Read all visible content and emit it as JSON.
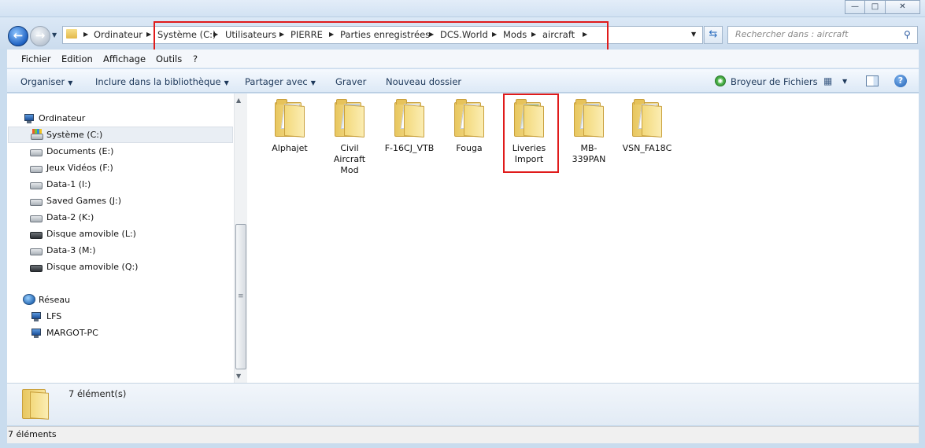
{
  "window": {
    "title": "",
    "minimize": "—",
    "maximize": "□",
    "close": "✕"
  },
  "address": {
    "crumbs": [
      "Ordinateur",
      "Système (C:)",
      "Utilisateurs",
      "PIERRE",
      "Parties enregistrées",
      "DCS.World",
      "Mods",
      "aircraft"
    ],
    "search_placeholder": "Rechercher dans : aircraft"
  },
  "menu": {
    "items": [
      "Fichier",
      "Edition",
      "Affichage",
      "Outils",
      "?"
    ]
  },
  "toolbar": {
    "organize": "Organiser",
    "include": "Inclure dans la bibliothèque",
    "share": "Partager avec",
    "burn": "Graver",
    "new_folder": "Nouveau dossier",
    "shredder": "Broyeur de Fichiers"
  },
  "nav": {
    "computer": "Ordinateur",
    "drives": [
      "Système (C:)",
      "Documents (E:)",
      "Jeux Vidéos (F:)",
      "Data-1 (I:)",
      "Saved Games (J:)",
      "Data-2 (K:)",
      "Disque amovible (L:)",
      "Data-3 (M:)",
      "Disque amovible (Q:)"
    ],
    "network": "Réseau",
    "network_items": [
      "LFS",
      "MARGOT-PC"
    ]
  },
  "files": [
    {
      "name": "Alphajet"
    },
    {
      "name": "Civil Aircraft Mod"
    },
    {
      "name": "F-16CJ_VTB"
    },
    {
      "name": "Fouga"
    },
    {
      "name": "Liveries Import"
    },
    {
      "name": "MB-339PAN"
    },
    {
      "name": "VSN_FA18C"
    }
  ],
  "details": {
    "count": "7 élément(s)"
  },
  "status": {
    "text": "7 éléments"
  },
  "icons": {
    "back": "back-arrow-icon",
    "forward": "forward-arrow-icon",
    "refresh": "refresh-icon",
    "search": "search-icon",
    "help": "help-icon"
  },
  "colors": {
    "highlight_red": "#e01b1b",
    "chrome_blue": "#c9dcee"
  }
}
